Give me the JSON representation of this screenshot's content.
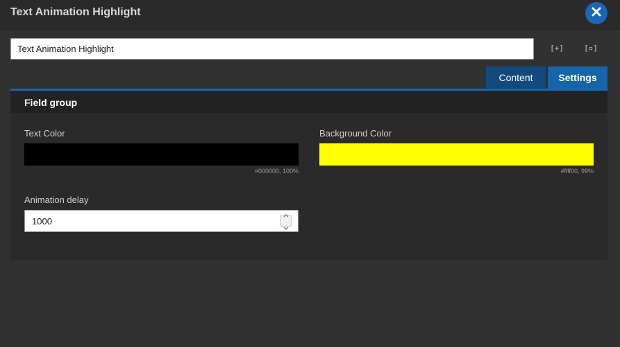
{
  "header": {
    "title": "Text Animation Highlight"
  },
  "name_input": {
    "value": "Text Animation Highlight"
  },
  "toolbar": {
    "expand_label": "[+]",
    "inspect_label": "[▫]"
  },
  "tabs": [
    {
      "label": "Content",
      "active": false
    },
    {
      "label": "Settings",
      "active": true
    }
  ],
  "field_group": {
    "title": "Field group",
    "text_color": {
      "label": "Text Color",
      "color": "#000000",
      "note": "#000000, 100%"
    },
    "background_color": {
      "label": "Background Color",
      "color": "#ffff00",
      "note": "#ffff00, 99%"
    },
    "animation_delay": {
      "label": "Animation delay",
      "value": "1000"
    }
  },
  "colors": {
    "accent": "#1565a8",
    "close_button": "#1a67b7",
    "background": "#313131"
  }
}
